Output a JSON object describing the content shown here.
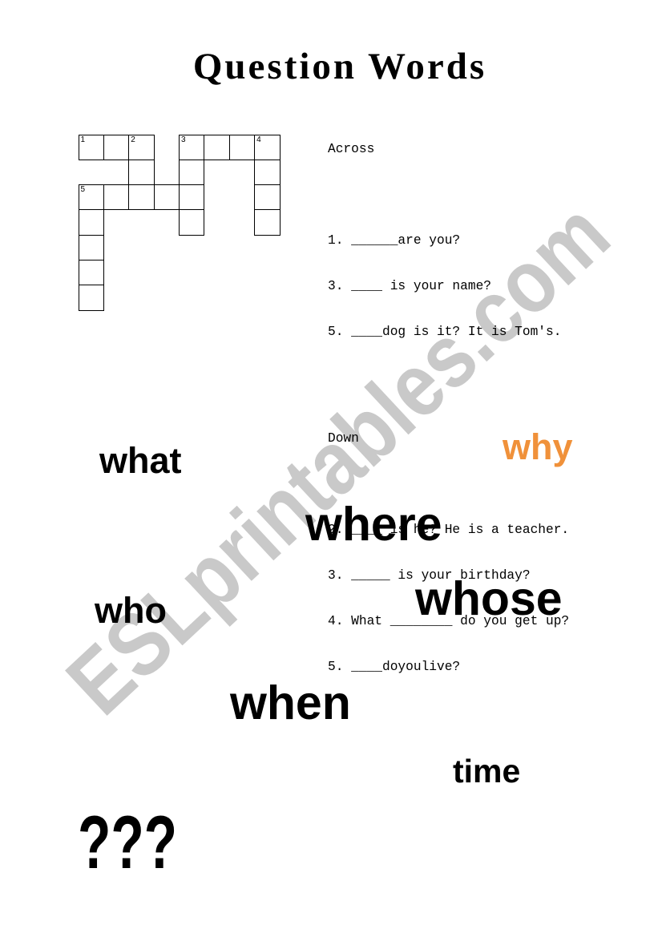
{
  "title": "Question Words",
  "watermark": "ESLprintables.com",
  "colors": {
    "text": "#000000",
    "accent_why": "#f0913a",
    "watermark": "#c9c9c9"
  },
  "crossword": {
    "cols": 8,
    "rows": 7,
    "cells": [
      {
        "r": 0,
        "c": 0,
        "num": "1"
      },
      {
        "r": 0,
        "c": 1,
        "num": ""
      },
      {
        "r": 0,
        "c": 2,
        "num": "2"
      },
      {
        "r": 0,
        "c": 4,
        "num": "3"
      },
      {
        "r": 0,
        "c": 5,
        "num": ""
      },
      {
        "r": 0,
        "c": 6,
        "num": ""
      },
      {
        "r": 0,
        "c": 7,
        "num": "4"
      },
      {
        "r": 1,
        "c": 2,
        "num": ""
      },
      {
        "r": 1,
        "c": 4,
        "num": ""
      },
      {
        "r": 1,
        "c": 7,
        "num": ""
      },
      {
        "r": 2,
        "c": 0,
        "num": "5"
      },
      {
        "r": 2,
        "c": 1,
        "num": ""
      },
      {
        "r": 2,
        "c": 2,
        "num": ""
      },
      {
        "r": 2,
        "c": 3,
        "num": ""
      },
      {
        "r": 2,
        "c": 4,
        "num": ""
      },
      {
        "r": 2,
        "c": 7,
        "num": ""
      },
      {
        "r": 3,
        "c": 0,
        "num": ""
      },
      {
        "r": 3,
        "c": 4,
        "num": ""
      },
      {
        "r": 3,
        "c": 7,
        "num": ""
      },
      {
        "r": 4,
        "c": 0,
        "num": ""
      },
      {
        "r": 5,
        "c": 0,
        "num": ""
      },
      {
        "r": 6,
        "c": 0,
        "num": ""
      }
    ]
  },
  "clues": {
    "across_heading": "Across",
    "across": [
      "1. ______are you?",
      "3. ____ is your name?",
      "5. ____dog is it? It is Tom's."
    ],
    "down_heading": "Down",
    "down": [
      "2. ____ is he? He is a teacher.",
      "3. _____ is your birthday?",
      "4. What ________ do you get up?",
      "5. ____doyoulive?"
    ]
  },
  "word_bank": {
    "what": "what",
    "why": "why",
    "where": "where",
    "who": "who",
    "whose": "whose",
    "when": "when",
    "time": "time",
    "question_marks": "???"
  }
}
